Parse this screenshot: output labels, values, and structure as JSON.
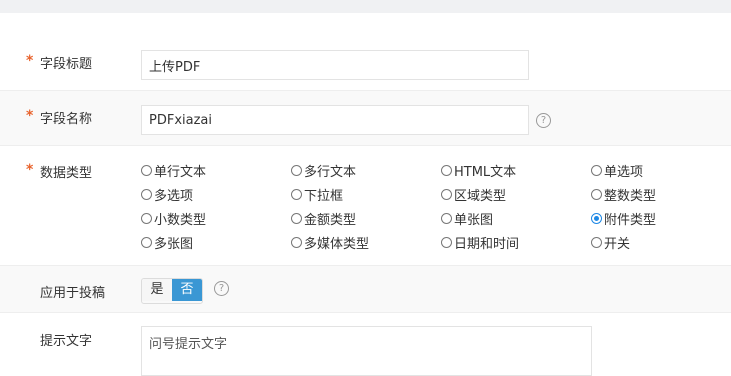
{
  "fields": {
    "title": {
      "required_mark": "*",
      "label": "字段标题",
      "value": "上传PDF"
    },
    "name": {
      "required_mark": "*",
      "label": "字段名称",
      "value": "PDFxiazai",
      "help_icon": "question-circle-icon"
    },
    "data_type": {
      "required_mark": "*",
      "label": "数据类型",
      "selected": "附件类型",
      "options": [
        "单行文本",
        "多行文本",
        "HTML文本",
        "单选项",
        "多选项",
        "下拉框",
        "区域类型",
        "整数类型",
        "小数类型",
        "金额类型",
        "单张图",
        "附件类型",
        "多张图",
        "多媒体类型",
        "日期和时间",
        "开关"
      ]
    },
    "apply_to_submission": {
      "label": "应用于投稿",
      "yes_label": "是",
      "no_label": "否",
      "selected": "否",
      "help_icon": "question-circle-icon"
    },
    "hint_text": {
      "label": "提示文字",
      "value": "问号提示文字"
    }
  },
  "colors": {
    "required": "#e8632d",
    "accent": "#3a97d4",
    "radio_checked": "#1e88e5",
    "top_bar": "#f0f1f3",
    "alt_row": "#f9f9f9"
  }
}
